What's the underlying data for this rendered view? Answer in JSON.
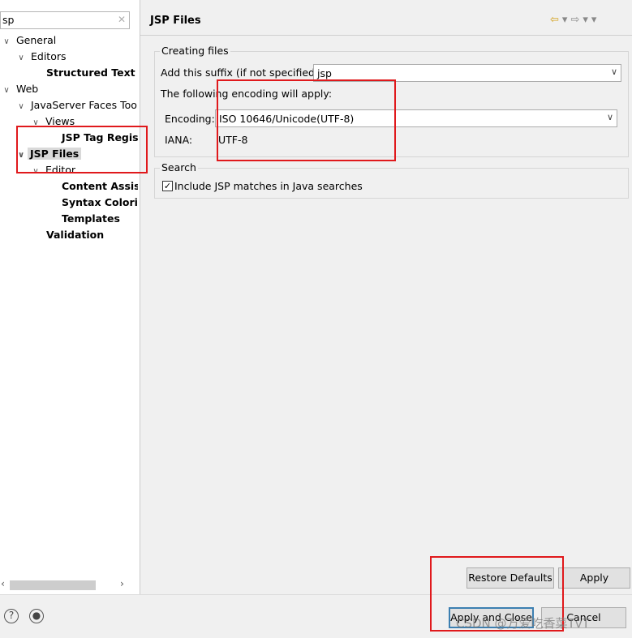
{
  "filter": {
    "value": "sp",
    "clear_icon": "eraser-icon"
  },
  "tree": {
    "general": "General",
    "editors": "Editors",
    "structured_text": "Structured Text E",
    "web": "Web",
    "jsf_tools": "JavaServer Faces Too",
    "views": "Views",
    "jsp_tag_registry": "JSP Tag Regis",
    "jsp_files": "JSP Files",
    "editor": "Editor",
    "content_assist": "Content Assis",
    "syntax_coloring": "Syntax Colori",
    "templates": "Templates",
    "validation": "Validation"
  },
  "page": {
    "title": "JSP Files",
    "creating_files": {
      "legend": "Creating files",
      "suffix_label": "Add this suffix (if not specified):",
      "suffix_value": "jsp",
      "encoding_note": "The following encoding will apply:",
      "encoding_label": "Encoding:",
      "encoding_value": "ISO 10646/Unicode(UTF-8)",
      "iana_label": "IANA:",
      "iana_value": "UTF-8"
    },
    "search": {
      "legend": "Search",
      "include_label": "Include JSP matches in Java searches",
      "include_checked": true
    }
  },
  "buttons": {
    "restore_defaults": "Restore Defaults",
    "apply": "Apply",
    "apply_and_close": "Apply and Close",
    "cancel": "Cancel"
  },
  "watermark": "CSDN @万爱吃香菜TvT",
  "colors": {
    "highlight_box": "#e0191c",
    "default_button_border": "#3c7fb1"
  }
}
